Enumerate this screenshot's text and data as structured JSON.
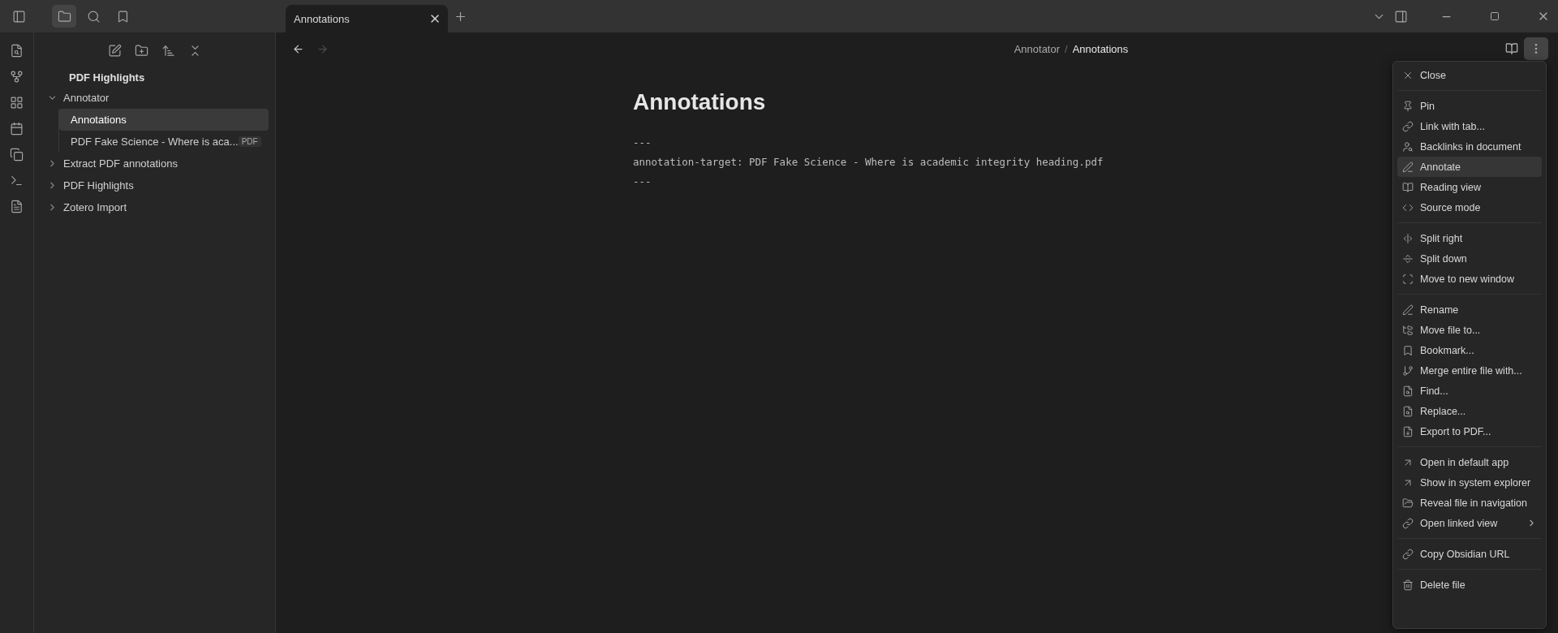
{
  "sidebar_tabs": [
    {
      "selected": true
    },
    {
      "selected": false
    },
    {
      "selected": false
    }
  ],
  "tabs": [
    {
      "label": "Annotations",
      "selected": true
    }
  ],
  "file_tree": {
    "vault": "PDF Highlights",
    "items": [
      {
        "label": "Annotator",
        "expanded": true,
        "selected": false,
        "children": [
          {
            "label": "Annotations",
            "selected": true
          },
          {
            "label": "PDF Fake Science - Where is aca...",
            "badge": "PDF",
            "selected": false
          }
        ]
      },
      {
        "label": "Extract PDF annotations",
        "expanded": false,
        "selected": false
      },
      {
        "label": "PDF Highlights",
        "expanded": false,
        "selected": false
      },
      {
        "label": "Zotero Import",
        "expanded": false,
        "selected": false
      }
    ]
  },
  "nav": [
    {
      "disabled": false
    },
    {
      "disabled": true
    }
  ],
  "breadcrumb": {
    "separator": "/",
    "items": [
      "Annotator",
      "Annotations"
    ]
  },
  "note": {
    "title": "Annotations",
    "lines": [
      "---",
      "annotation-target: PDF Fake Science - Where is academic integrity heading.pdf",
      "---"
    ]
  },
  "menu": [
    [
      {
        "label": "Close",
        "highlighted": false
      }
    ],
    [
      {
        "label": "Pin",
        "highlighted": false
      },
      {
        "label": "Link with tab...",
        "highlighted": false
      },
      {
        "label": "Backlinks in document",
        "highlighted": false
      },
      {
        "label": "Annotate",
        "highlighted": true
      },
      {
        "label": "Reading view",
        "highlighted": false
      },
      {
        "label": "Source mode",
        "highlighted": false
      }
    ],
    [
      {
        "label": "Split right",
        "highlighted": false
      },
      {
        "label": "Split down",
        "highlighted": false
      },
      {
        "label": "Move to new window",
        "highlighted": false
      }
    ],
    [
      {
        "label": "Rename",
        "highlighted": false
      },
      {
        "label": "Move file to...",
        "highlighted": false
      },
      {
        "label": "Bookmark...",
        "highlighted": false
      },
      {
        "label": "Merge entire file with...",
        "highlighted": false
      },
      {
        "label": "Find...",
        "highlighted": false
      },
      {
        "label": "Replace...",
        "highlighted": false
      },
      {
        "label": "Export to PDF...",
        "highlighted": false
      }
    ],
    [
      {
        "label": "Open in default app",
        "highlighted": false
      },
      {
        "label": "Show in system explorer",
        "highlighted": false
      },
      {
        "label": "Reveal file in navigation",
        "highlighted": false
      },
      {
        "label": "Open linked view",
        "highlighted": false,
        "submenu": true
      }
    ],
    [
      {
        "label": "Copy Obsidian URL",
        "highlighted": false
      }
    ],
    [
      {
        "label": "Delete file",
        "highlighted": false
      }
    ]
  ]
}
